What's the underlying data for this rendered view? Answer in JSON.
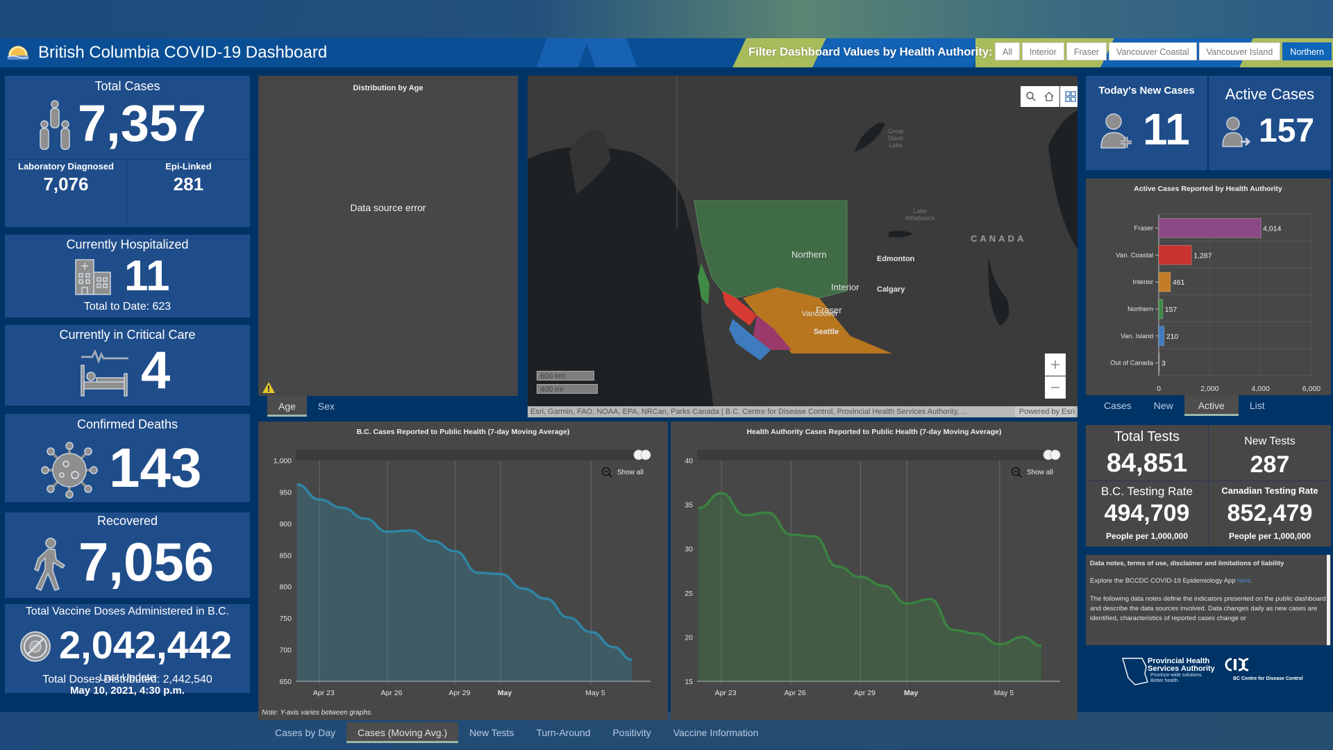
{
  "header": {
    "title": "British Columbia COVID-19 Dashboard",
    "filter_label": "Filter Dashboard Values by Health Authority:",
    "filters": [
      {
        "label": "All",
        "active": false
      },
      {
        "label": "Interior",
        "active": false
      },
      {
        "label": "Fraser",
        "active": false
      },
      {
        "label": "Vancouver Coastal",
        "active": false
      },
      {
        "label": "Vancouver Island",
        "active": false
      },
      {
        "label": "Northern",
        "active": true
      }
    ]
  },
  "left": {
    "total_cases": {
      "label": "Total Cases",
      "value": "7,357",
      "lab_label": "Laboratory Diagnosed",
      "lab_value": "7,076",
      "epi_label": "Epi-Linked",
      "epi_value": "281",
      "icon": "people-group-icon"
    },
    "hospitalized": {
      "label": "Currently Hospitalized",
      "value": "11",
      "sub": "Total to Date: 623",
      "icon": "hospital-icon"
    },
    "critical": {
      "label": "Currently in Critical Care",
      "value": "4",
      "icon": "hospital-bed-icon"
    },
    "deaths": {
      "label": "Confirmed Deaths",
      "value": "143",
      "icon": "virus-icon"
    },
    "recovered": {
      "label": "Recovered",
      "value": "7,056",
      "icon": "walking-person-icon"
    },
    "vaccine": {
      "label": "Total Vaccine Doses Administered in B.C.",
      "value": "2,042,442",
      "sub": "Total Doses Distributed: 2,442,540",
      "icon": "no-virus-icon"
    },
    "last_update": {
      "label": "Last Update",
      "value": "May 10, 2021, 4:30 p.m."
    }
  },
  "age_panel": {
    "title": "Distribution by Age",
    "error": "Data source error",
    "tabs": [
      {
        "label": "Age",
        "active": true
      },
      {
        "label": "Sex",
        "active": false
      }
    ]
  },
  "map": {
    "labels": {
      "northern": "Northern",
      "interior": "Interior",
      "fraser": "Fraser",
      "vancouver": "Vancouver",
      "seattle": "Seattle",
      "edmonton": "Edmonton",
      "calgary": "Calgary",
      "canada": "CANADA",
      "great_slave": "Great Slave Lake",
      "athabasca": "Lake Athabasca"
    },
    "scale_km": "600 km",
    "scale_mi": "400 mi",
    "attribution": "Esri, Garmin, FAO, NOAA, EPA, NRCan, Parks Canada | B.C. Centre for Disease Control, Provincial Health Services Authority, ...",
    "powered_by": "Powered by Esri",
    "region_colors": {
      "northern": "#3f6b45",
      "interior": "#b8761f",
      "fraser": "#9b3a6a",
      "coastal": "#d63a32",
      "island": "#3e7bbf"
    }
  },
  "right": {
    "new_cases": {
      "label": "Today's New Cases",
      "value": "11",
      "icon": "person-add-icon"
    },
    "active_cases": {
      "label": "Active Cases",
      "value": "157",
      "icon": "person-arrow-icon"
    },
    "tabs": [
      {
        "label": "Cases",
        "active": false
      },
      {
        "label": "New",
        "active": false
      },
      {
        "label": "Active",
        "active": true
      },
      {
        "label": "List",
        "active": false
      }
    ],
    "tests": {
      "total_label": "Total Tests",
      "total_value": "84,851",
      "new_label": "New Tests",
      "new_value": "287",
      "bc_rate_label": "B.C. Testing Rate",
      "bc_rate_value": "494,709",
      "bc_rate_unit": "People per 1,000,000",
      "ca_rate_label": "Canadian Testing Rate",
      "ca_rate_value": "852,479",
      "ca_rate_unit": "People per 1,000,000"
    },
    "notes": {
      "heading": "Data notes, terms of use, disclaimer and limitations of liability",
      "explore": "Explore the BCCDC COVID-19 Epidemiology App ",
      "explore_link": "here",
      "body": "The following data notes define the indicators presented on the public dashboard and describe the data sources involved. Data changes daily as new cases are identified, characteristics of reported cases change or"
    },
    "logos": {
      "phsa_line1": "Provincial Health",
      "phsa_line2": "Services Authority",
      "phsa_tag1": "Province-wide solutions.",
      "phsa_tag2": "Better health.",
      "bccdc": "BC Centre for Disease Control"
    }
  },
  "bottom": {
    "note": "Note: Y-axis varies between graphs.",
    "show_all": "Show all",
    "tabs": [
      {
        "label": "Cases by Day",
        "active": false
      },
      {
        "label": "Cases (Moving Avg.)",
        "active": true
      },
      {
        "label": "New Tests",
        "active": false
      },
      {
        "label": "Turn-Around",
        "active": false
      },
      {
        "label": "Positivity",
        "active": false
      },
      {
        "label": "Vaccine Information",
        "active": false
      }
    ]
  },
  "chart_data": [
    {
      "id": "active_by_ha",
      "type": "bar",
      "orientation": "horizontal",
      "title": "Active Cases Reported by Health Authority",
      "categories": [
        "Fraser",
        "Van. Coastal",
        "Interior",
        "Northern",
        "Van. Island",
        "Out of Canada"
      ],
      "values": [
        4014,
        1287,
        461,
        157,
        210,
        3
      ],
      "value_labels": [
        "4,014",
        "1,287",
        "461",
        "157",
        "210",
        "3"
      ],
      "colors": [
        "#8b4a86",
        "#c8322f",
        "#c27d25",
        "#3e8a45",
        "#3f7cbf",
        "#888888"
      ],
      "xlim": [
        0,
        6000
      ],
      "xticks": [
        0,
        2000,
        4000,
        6000
      ],
      "xtick_labels": [
        "0",
        "2,000",
        "4,000",
        "6,000"
      ],
      "grid": true
    },
    {
      "id": "bc_moving_avg",
      "type": "area",
      "title": "B.C. Cases Reported to Public Health (7-day Moving Average)",
      "x": [
        "Apr 22",
        "Apr 23",
        "Apr 24",
        "Apr 25",
        "Apr 26",
        "Apr 27",
        "Apr 28",
        "Apr 29",
        "Apr 30",
        "May 1",
        "May 2",
        "May 3",
        "May 4",
        "May 5",
        "May 6"
      ],
      "values": [
        962,
        938,
        925,
        908,
        887,
        889,
        872,
        856,
        822,
        820,
        797,
        781,
        751,
        728,
        704
      ],
      "end_value": 684,
      "color": "#2c8fb1",
      "ylim": [
        650,
        1000
      ],
      "yticks": [
        650,
        700,
        750,
        800,
        850,
        900,
        950,
        1000
      ],
      "ytick_labels": [
        "650",
        "700",
        "750",
        "800",
        "850",
        "900",
        "950",
        "1,000"
      ],
      "xtick_labels": [
        {
          "label": "Apr 23",
          "day": 1
        },
        {
          "label": "Apr 26",
          "day": 4
        },
        {
          "label": "Apr 29",
          "day": 7
        },
        {
          "label": "May",
          "day": 9,
          "bold": true
        },
        {
          "label": "May 5",
          "day": 13
        }
      ],
      "grid": true
    },
    {
      "id": "ha_moving_avg",
      "type": "area",
      "title": "Health Authority Cases Reported to Public Health (7-day Moving Average)",
      "x": [
        "Apr 22",
        "Apr 23",
        "Apr 24",
        "Apr 25",
        "Apr 26",
        "Apr 27",
        "Apr 28",
        "Apr 29",
        "Apr 30",
        "May 1",
        "May 2",
        "May 3",
        "May 4",
        "May 5",
        "May 6"
      ],
      "values": [
        34.6,
        36.3,
        33.8,
        34.1,
        31.6,
        31.4,
        28.0,
        26.8,
        25.8,
        23.8,
        24.3,
        20.8,
        20.4,
        19.2,
        20.0
      ],
      "end_value": 19.0,
      "color": "#3a8c42",
      "ylim": [
        15,
        40
      ],
      "yticks": [
        15,
        20,
        25,
        30,
        35,
        40
      ],
      "ytick_labels": [
        "15",
        "20",
        "25",
        "30",
        "35",
        "40"
      ],
      "xtick_labels": [
        {
          "label": "Apr 23",
          "day": 1
        },
        {
          "label": "Apr 26",
          "day": 4
        },
        {
          "label": "Apr 29",
          "day": 7
        },
        {
          "label": "May",
          "day": 9,
          "bold": true
        },
        {
          "label": "May 5",
          "day": 13
        }
      ],
      "grid": true
    }
  ]
}
